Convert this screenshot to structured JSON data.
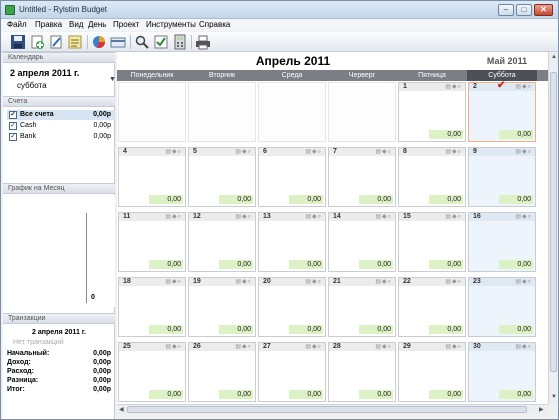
{
  "window": {
    "title": "Untitled - Rylstim Budget"
  },
  "menu": [
    "Файл",
    "Правка",
    "Вид",
    "День",
    "Проект",
    "Инструменты",
    "Справка"
  ],
  "toolbar": [
    "save-icon",
    "new-icon",
    "edit-icon",
    "notes-icon",
    "chart-icon",
    "card-icon",
    "search-icon",
    "check-icon",
    "calculator-icon",
    "print-icon"
  ],
  "left": {
    "calendar_header": "Календарь",
    "date_main": "2 апреля 2011 г.",
    "date_day": "суббота",
    "accounts_header": "Счета",
    "accounts": [
      {
        "name": "Все счета",
        "value": "0,00р",
        "checked": true
      },
      {
        "name": "Cash",
        "value": "0,00р",
        "checked": true
      },
      {
        "name": "Bank",
        "value": "0,00р",
        "checked": true
      }
    ],
    "graph_header": "График на Месяц",
    "graph_zero": "0",
    "tx_header": "Транзакции",
    "tx_date": "2 апреля 2011 г.",
    "tx_none": "Нет транзакций",
    "summary": [
      {
        "label": "Начальный:",
        "value": "0,00р"
      },
      {
        "label": "Доход:",
        "value": "0,00р"
      },
      {
        "label": "Расход:",
        "value": "0,00р"
      },
      {
        "label": "Разница:",
        "value": "0,00р"
      },
      {
        "label": "Итог:",
        "value": "0,00р"
      }
    ]
  },
  "calendar": {
    "month_title": "Апрель 2011",
    "next_month": "Май 2011",
    "weekdays": [
      "Понедельник",
      "Вторник",
      "Среда",
      "Черверг",
      "Пятница",
      "Суббота"
    ],
    "cell_value": "0,00",
    "weeks": [
      [
        null,
        null,
        null,
        null,
        1,
        2
      ],
      [
        4,
        5,
        6,
        7,
        8,
        9
      ],
      [
        11,
        12,
        13,
        14,
        15,
        16
      ],
      [
        18,
        19,
        20,
        21,
        22,
        23
      ],
      [
        25,
        26,
        27,
        28,
        29,
        30
      ]
    ],
    "today": 2
  },
  "colors": {
    "accent_check": "#d0281b",
    "value_bg": "#ddf2c4",
    "header_bg": "#7b7e84",
    "saturday_bg": "#edf4fb"
  }
}
